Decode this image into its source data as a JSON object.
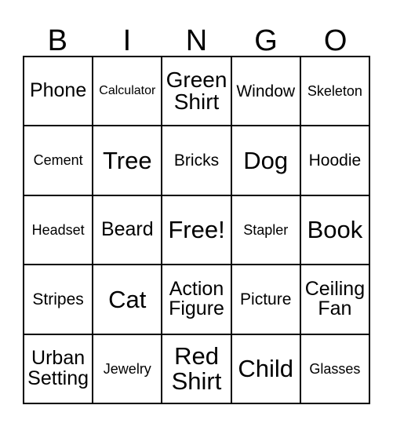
{
  "card": {
    "header_letters": [
      "B",
      "I",
      "N",
      "G",
      "O"
    ],
    "grid_color": "#000000",
    "background_color": "#ffffff",
    "rows": 5,
    "columns": 5,
    "cells": [
      [
        {
          "text": "Phone",
          "size": "fs-l"
        },
        {
          "text": "Calculator",
          "size": "fs-xs"
        },
        {
          "text": "Green\nShirt",
          "size": "fs-xl"
        },
        {
          "text": "Window",
          "size": "fs-m"
        },
        {
          "text": "Skeleton",
          "size": "fs-s"
        }
      ],
      [
        {
          "text": "Cement",
          "size": "fs-s"
        },
        {
          "text": "Tree",
          "size": "fs-xxl"
        },
        {
          "text": "Bricks",
          "size": "fs-m"
        },
        {
          "text": "Dog",
          "size": "fs-xxl"
        },
        {
          "text": "Hoodie",
          "size": "fs-m"
        }
      ],
      [
        {
          "text": "Headset",
          "size": "fs-s"
        },
        {
          "text": "Beard",
          "size": "fs-l"
        },
        {
          "text": "Free!",
          "size": "fs-xxl"
        },
        {
          "text": "Stapler",
          "size": "fs-s"
        },
        {
          "text": "Book",
          "size": "fs-xxl"
        }
      ],
      [
        {
          "text": "Stripes",
          "size": "fs-m"
        },
        {
          "text": "Cat",
          "size": "fs-xxl"
        },
        {
          "text": "Action\nFigure",
          "size": "fs-l"
        },
        {
          "text": "Picture",
          "size": "fs-m"
        },
        {
          "text": "Ceiling\nFan",
          "size": "fs-l"
        }
      ],
      [
        {
          "text": "Urban\nSetting",
          "size": "fs-l"
        },
        {
          "text": "Jewelry",
          "size": "fs-s"
        },
        {
          "text": "Red\nShirt",
          "size": "fs-xxl"
        },
        {
          "text": "Child",
          "size": "fs-xxl"
        },
        {
          "text": "Glasses",
          "size": "fs-s"
        }
      ]
    ]
  }
}
